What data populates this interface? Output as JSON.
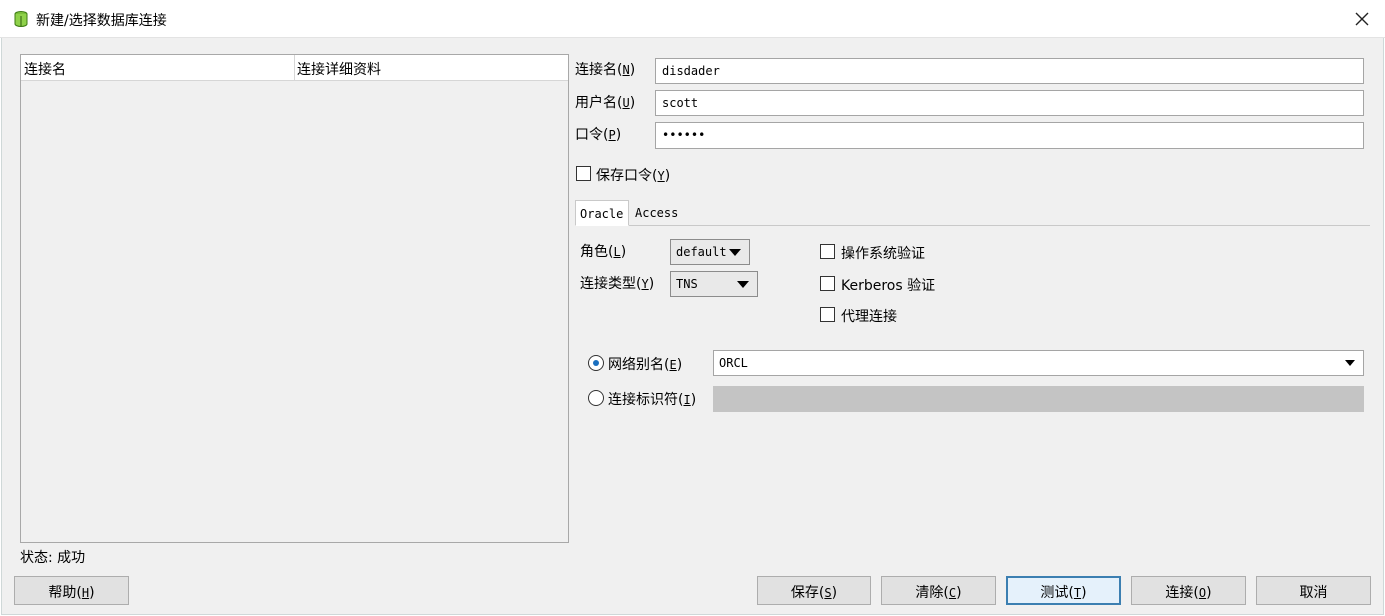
{
  "window": {
    "title": "新建/选择数据库连接"
  },
  "table": {
    "columns": [
      "连接名",
      "连接详细资料"
    ]
  },
  "status": {
    "text": "状态: 成功"
  },
  "form": {
    "conn_name": {
      "label": "连接名",
      "key": "N",
      "value": "disdader"
    },
    "username": {
      "label": "用户名",
      "key": "U",
      "value": "scott"
    },
    "password": {
      "label": "口令",
      "key": "P",
      "value": "••••••"
    },
    "save_password": {
      "label": "保存口令",
      "key": "Y",
      "checked": false
    }
  },
  "tabs": [
    "Oracle",
    "Access"
  ],
  "oracle": {
    "role": {
      "label": "角色",
      "key": "L",
      "value": "default"
    },
    "conn_type": {
      "label": "连接类型",
      "key": "Y",
      "value": "TNS"
    },
    "os_auth": {
      "label": "操作系统验证",
      "checked": false
    },
    "kerberos": {
      "label": "Kerberos 验证",
      "checked": false
    },
    "proxy": {
      "label": "代理连接",
      "checked": false
    },
    "net_alias": {
      "label": "网络别名",
      "key": "E",
      "selected": true,
      "value": "ORCL"
    },
    "conn_id": {
      "label": "连接标识符",
      "key": "I",
      "selected": false,
      "value": ""
    }
  },
  "buttons": {
    "help": {
      "label": "帮助",
      "key": "H"
    },
    "save": {
      "label": "保存",
      "key": "S"
    },
    "clear": {
      "label": "清除",
      "key": "C"
    },
    "test": {
      "label": "测试",
      "key": "T"
    },
    "connect": {
      "label": "连接",
      "key": "O"
    },
    "cancel": {
      "label": "取消"
    }
  },
  "colors": {
    "accent": "#3c7fb1",
    "radio_dot": "#1a6fbf"
  }
}
